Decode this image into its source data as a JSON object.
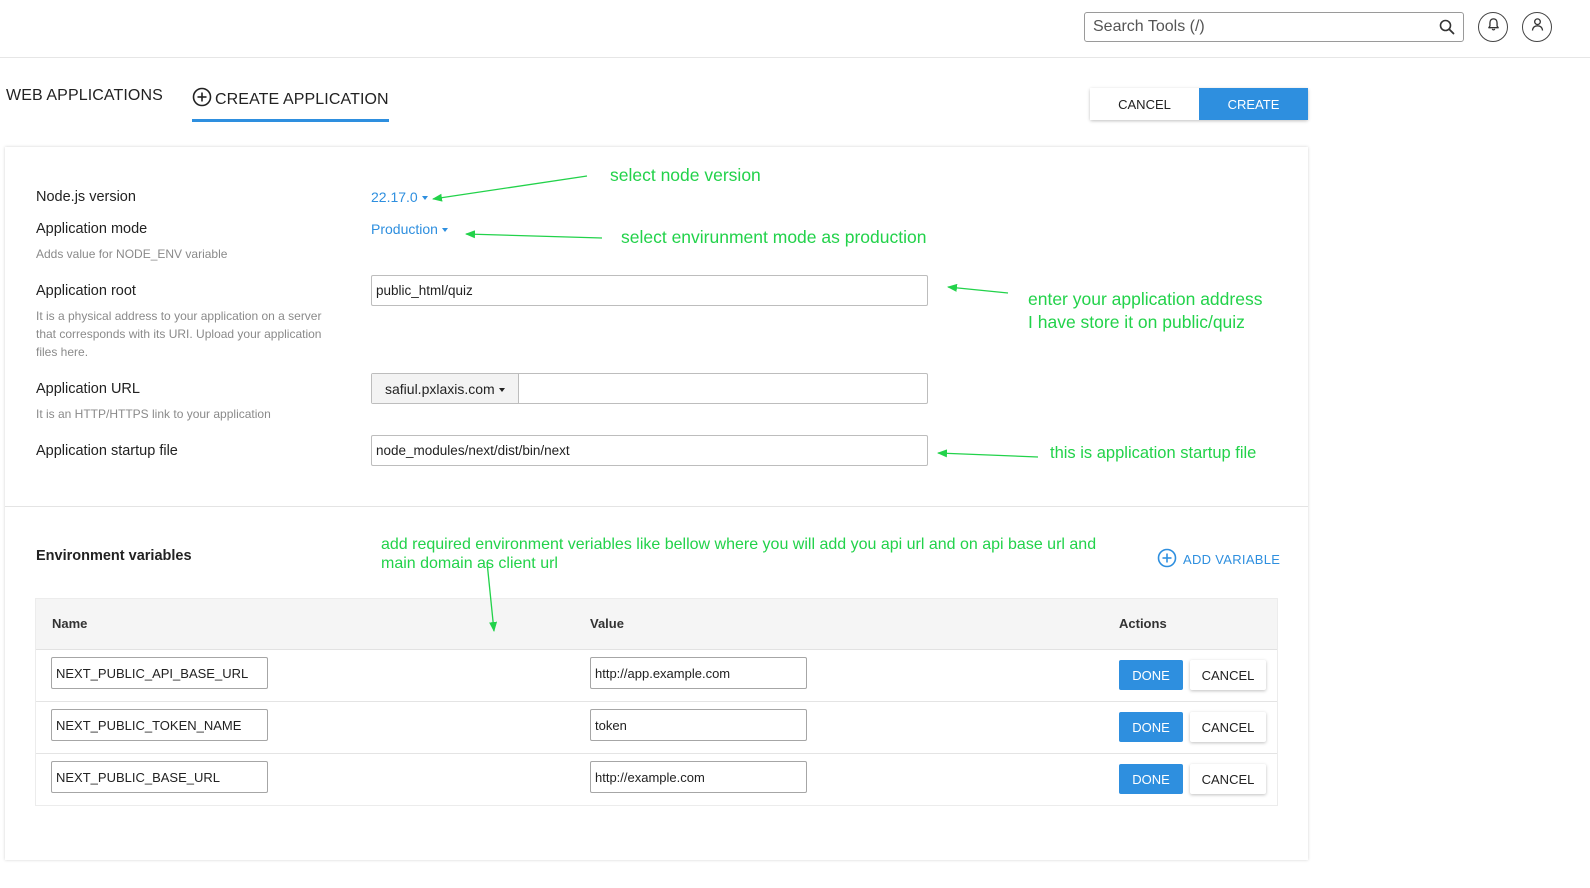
{
  "header": {
    "search_placeholder": "Search Tools (/)",
    "search_icon": "search-icon",
    "notifications_icon": "bell-icon",
    "user_icon": "user-icon"
  },
  "tabs": [
    {
      "label": "WEB APPLICATIONS",
      "active": false
    },
    {
      "label": "CREATE APPLICATION",
      "active": true,
      "icon": "plus-circle-icon"
    }
  ],
  "actions": {
    "cancel": "CANCEL",
    "create": "CREATE"
  },
  "form": {
    "node_version": {
      "label": "Node.js version",
      "value": "22.17.0"
    },
    "app_mode": {
      "label": "Application mode",
      "value": "Production",
      "hint": "Adds value for NODE_ENV variable"
    },
    "app_root": {
      "label": "Application root",
      "value": "public_html/quiz",
      "hint": "It is a physical address to your application on a server that corresponds with its URI. Upload your application files here."
    },
    "app_url": {
      "label": "Application URL",
      "domain": "safiul.pxlaxis.com",
      "value": "",
      "hint": "It is an HTTP/HTTPS link to your application"
    },
    "startup_file": {
      "label": "Application startup file",
      "value": "node_modules/next/dist/bin/next"
    }
  },
  "env": {
    "title": "Environment variables",
    "add_label": "ADD VARIABLE",
    "columns": {
      "name": "Name",
      "value": "Value",
      "actions": "Actions"
    },
    "rows": [
      {
        "name": "NEXT_PUBLIC_API_BASE_URL",
        "value": "http://app.example.com",
        "done": "DONE",
        "cancel": "CANCEL"
      },
      {
        "name": "NEXT_PUBLIC_TOKEN_NAME",
        "value": "token",
        "done": "DONE",
        "cancel": "CANCEL"
      },
      {
        "name": "NEXT_PUBLIC_BASE_URL",
        "value": "http://example.com",
        "done": "DONE",
        "cancel": "CANCEL"
      }
    ]
  },
  "annotations": {
    "node_version": "select node version",
    "app_mode": "select envirunment mode as production",
    "app_root_1": "enter your application address",
    "app_root_2": "I have store it on public/quiz",
    "startup": "this is application startup file",
    "env_1": "add required environment veriables like bellow where you will add you api url and on api base url and",
    "env_2": "main domain as client url"
  },
  "colors": {
    "accent": "#2e8fdf",
    "annotation": "#22d24a"
  }
}
